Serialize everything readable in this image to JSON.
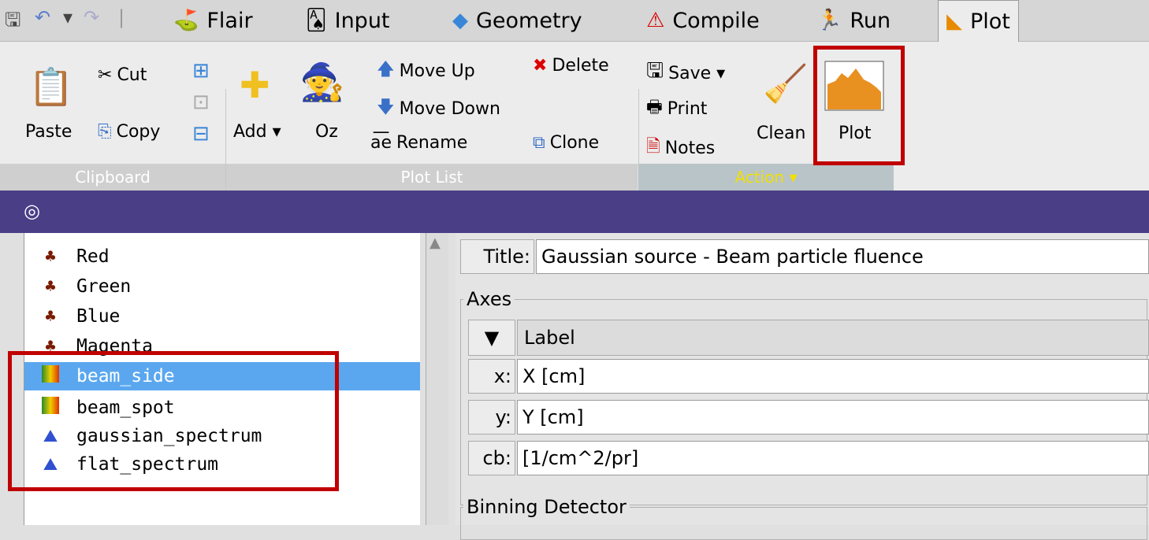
{
  "quick_access": {
    "save_icon": "floppy-icon",
    "undo_icon": "undo-icon",
    "redo_icon": "redo-icon"
  },
  "tabs": [
    {
      "label": "Flair",
      "icon": "cauldron-icon"
    },
    {
      "label": "Input",
      "icon": "dice-icon"
    },
    {
      "label": "Geometry",
      "icon": "geometry-icon"
    },
    {
      "label": "Compile",
      "icon": "warning-triangle-icon"
    },
    {
      "label": "Run",
      "icon": "runner-icon"
    },
    {
      "label": "Plot",
      "icon": "plot-icon",
      "active": true
    }
  ],
  "ribbon": {
    "clipboard": {
      "paste": "Paste",
      "cut": "Cut",
      "copy": "Copy",
      "group": "Clipboard"
    },
    "plotlist": {
      "add": "Add ▾",
      "oz": "Oz",
      "move_up": "Move Up",
      "move_down": "Move Down",
      "rename": "Rename",
      "delete": "Delete",
      "clone": "Clone",
      "group": "Plot List"
    },
    "action": {
      "save": "Save ▾",
      "print": "Print",
      "notes": "Notes",
      "clean": "Clean",
      "plot": "Plot",
      "group": "Action ▾"
    }
  },
  "plot_list": [
    {
      "name": "Red",
      "icon": "detector-icon"
    },
    {
      "name": "Green",
      "icon": "detector-icon"
    },
    {
      "name": "Blue",
      "icon": "detector-icon"
    },
    {
      "name": "Magenta",
      "icon": "detector-icon"
    },
    {
      "name": "beam_side",
      "icon": "heatmap-icon",
      "selected": true
    },
    {
      "name": "beam_spot",
      "icon": "heatmap-icon"
    },
    {
      "name": "gaussian_spectrum",
      "icon": "spectrum-icon"
    },
    {
      "name": "flat_spectrum",
      "icon": "spectrum-icon"
    }
  ],
  "form": {
    "title_label": "Title:",
    "title_value": "Gaussian source - Beam particle fluence",
    "axes_legend": "Axes",
    "toggle_symbol": "▼",
    "label_header": "Label",
    "x_label": "x:",
    "x_value": "X [cm]",
    "y_label": "y:",
    "y_value": "Y [cm]",
    "cb_label": "cb:",
    "cb_value": "[1/cm^2/pr]",
    "binning_legend": "Binning Detector"
  },
  "colors": {
    "menubar": "#d6d6d6",
    "ribbon": "#ececec",
    "selection": "#5aa7ef",
    "purple_bar": "#4a3f86",
    "highlight": "#c00000",
    "action_group": "#f0e000"
  }
}
